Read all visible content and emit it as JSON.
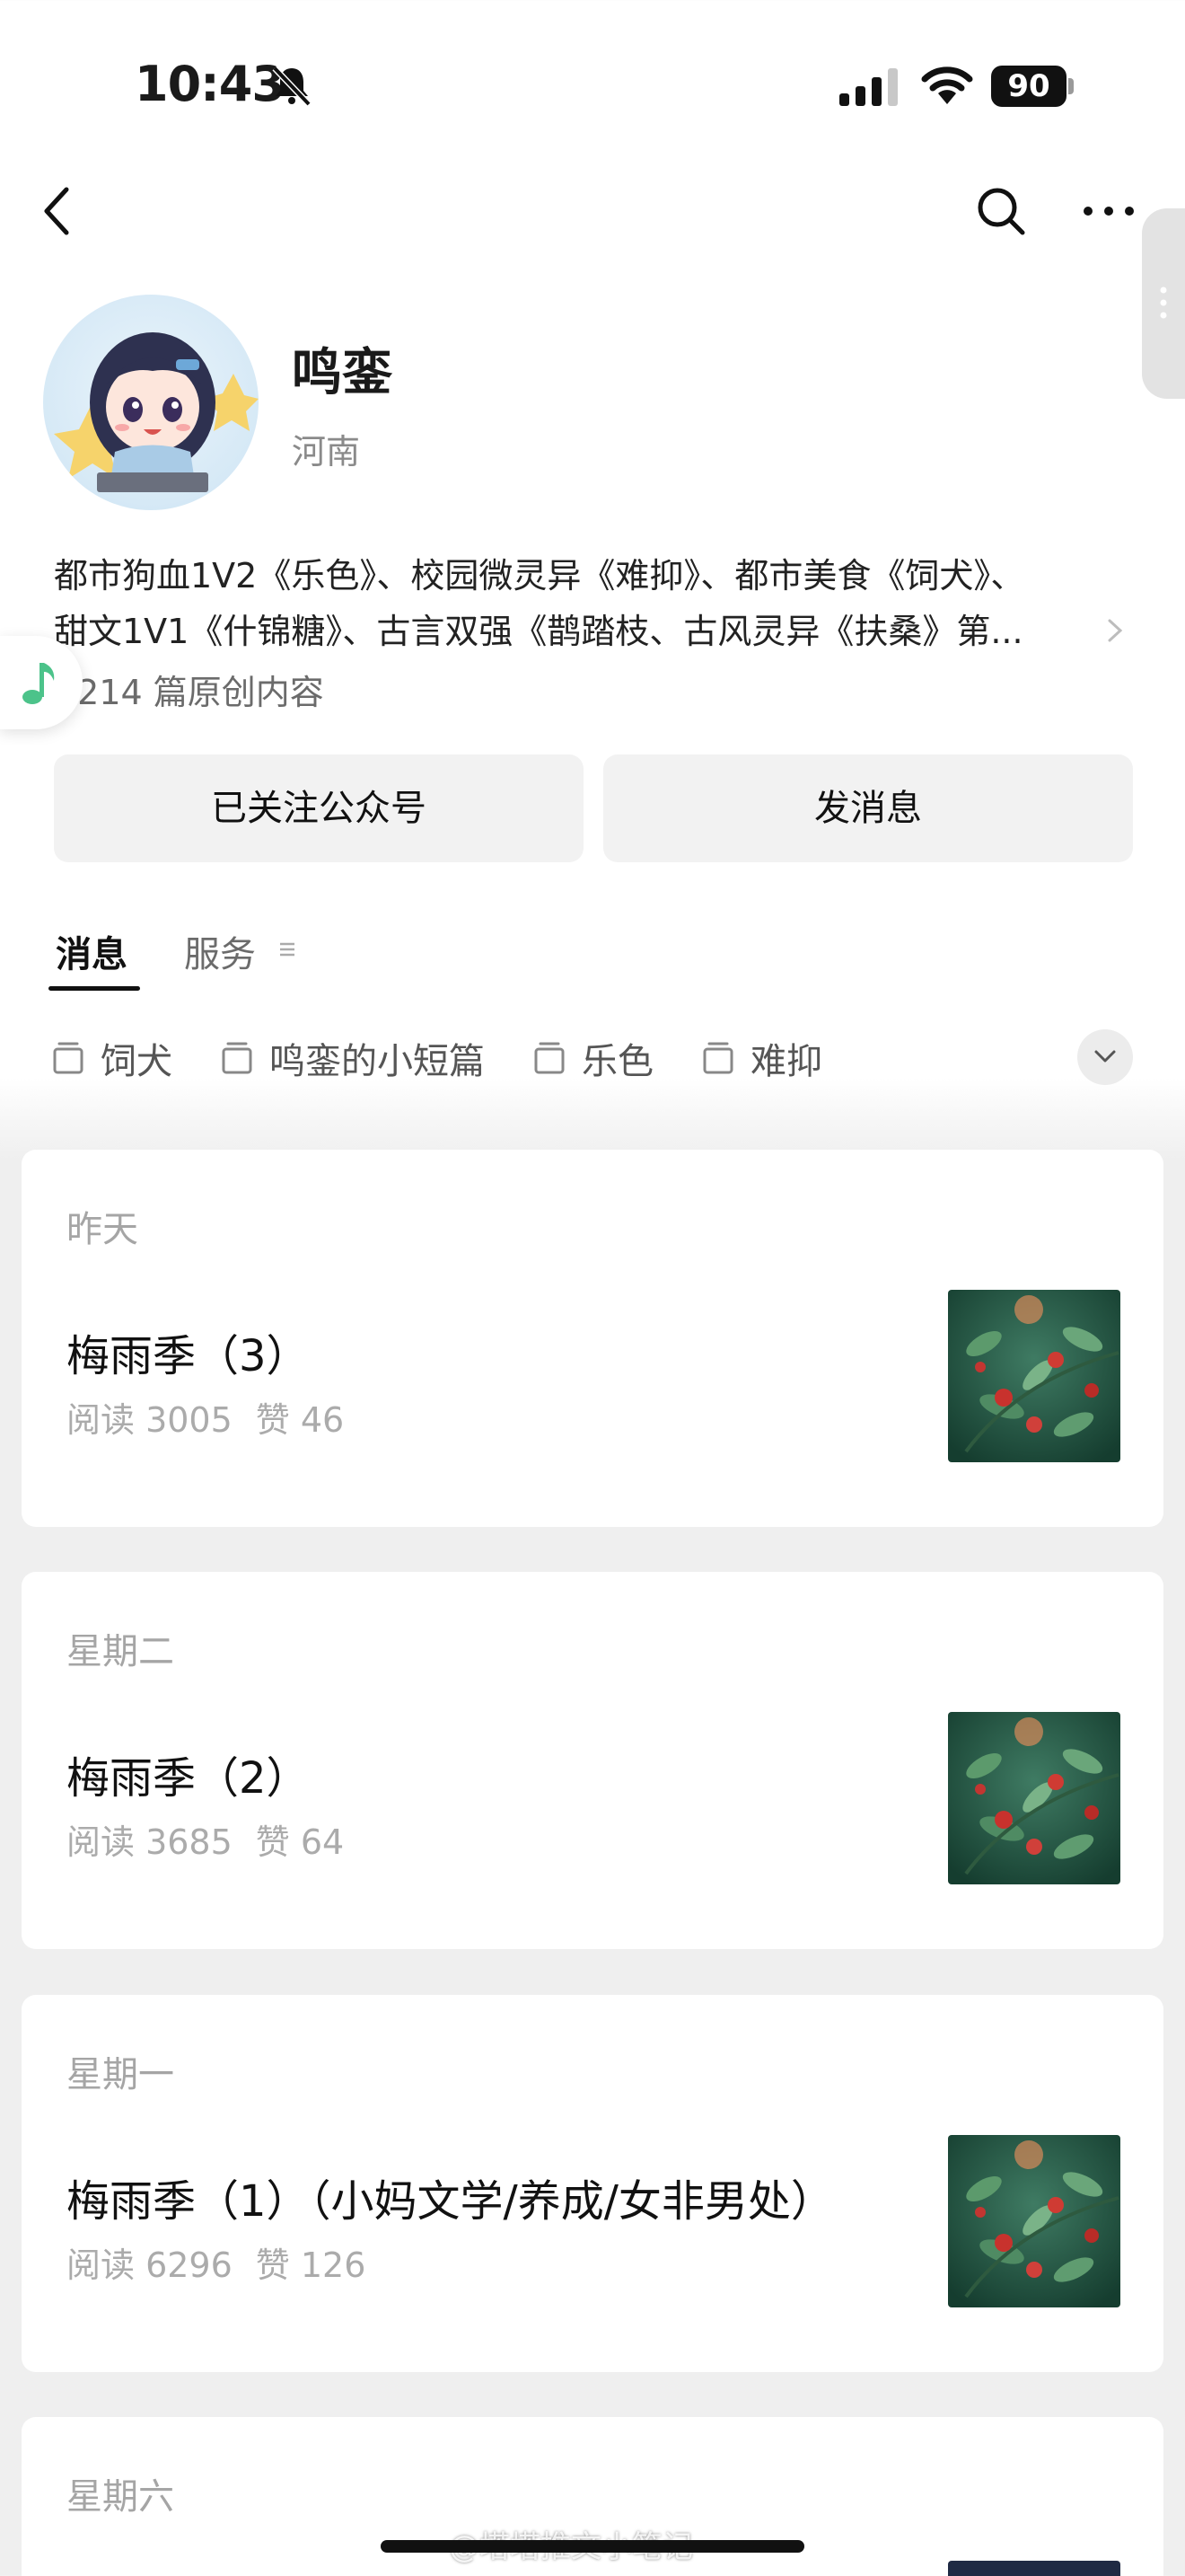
{
  "status_bar": {
    "time": "10:43",
    "battery": "90"
  },
  "account": {
    "name": "鸣銮",
    "region": "河南",
    "description_lines": [
      "都市狗血1V2《乐色》、校园微灵异《难抑》、都市美食《饲犬》、",
      "甜文1V1《什锦糖》、古言双强《鹊踏枝、古风灵异《扶桑》第..."
    ],
    "original_count": "1214 篇原创内容"
  },
  "buttons": {
    "follow": "已关注公众号",
    "message": "发消息"
  },
  "tabs": [
    {
      "label": "消息"
    },
    {
      "label": "服务"
    }
  ],
  "collections": [
    {
      "label": "饲犬"
    },
    {
      "label": "鸣銮的小短篇"
    },
    {
      "label": "乐色"
    },
    {
      "label": "难抑"
    }
  ],
  "articles": [
    {
      "day": "昨天",
      "title": "梅雨季（3）",
      "reads": "阅读 3005",
      "likes": "赞 46"
    },
    {
      "day": "星期二",
      "title": "梅雨季（2）",
      "reads": "阅读 3685",
      "likes": "赞 64"
    },
    {
      "day": "星期一",
      "title": "梅雨季（1）（小妈文学/养成/女非男处）",
      "reads": "阅读 6296",
      "likes": "赞 126"
    },
    {
      "day": "星期六"
    }
  ],
  "watermark": "@塔塔推文小笔记"
}
